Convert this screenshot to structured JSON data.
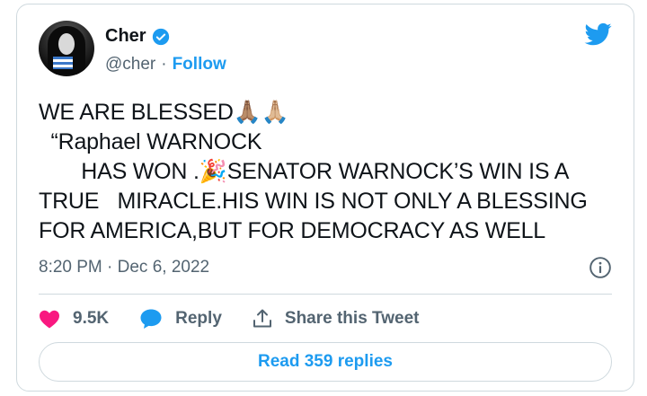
{
  "author": {
    "name": "Cher",
    "handle": "@cher",
    "separator": "·",
    "follow_label": "Follow",
    "verified": true
  },
  "tweet": {
    "text": "WE ARE BLESSED🙏🏽🙏🏼\n  “Raphael WARNOCK\n       HAS WON .🎉SENATOR WARNOCK’S WIN IS A\nTRUE   MIRACLE.HIS WIN IS NOT ONLY A BLESSING\nFOR AMERICA,BUT FOR DEMOCRACY AS WELL",
    "timestamp": "8:20 PM · Dec 6, 2022"
  },
  "actions": {
    "like_count": "9.5K",
    "reply_label": "Reply",
    "share_label": "Share this Tweet"
  },
  "read_replies_label": "Read 359 replies",
  "icons": {
    "brand": "twitter-bird-icon",
    "verified": "verified-badge-icon",
    "info": "info-icon",
    "like": "heart-icon",
    "reply": "speech-bubble-icon",
    "share": "share-upload-icon"
  },
  "colors": {
    "accent": "#1d9bf0",
    "like": "#f91880",
    "secondary_text": "#536471",
    "border": "#cfd9de"
  }
}
